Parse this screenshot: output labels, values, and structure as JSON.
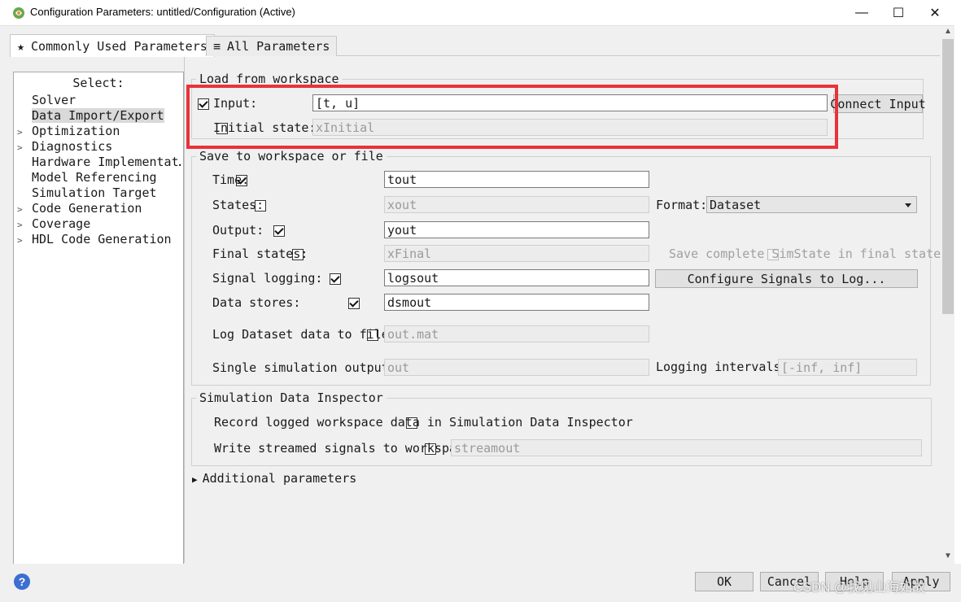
{
  "window": {
    "title": "Configuration Parameters: untitled/Configuration (Active)",
    "minimize": "—",
    "maximize": "☐",
    "close": "✕"
  },
  "tabs": [
    {
      "label": "Commonly Used Parameters",
      "icon": "star-icon",
      "active": true
    },
    {
      "label": "All Parameters",
      "icon": "list-icon",
      "active": false
    }
  ],
  "tree": {
    "title": "Select:",
    "items": [
      {
        "label": "Solver",
        "expandable": false
      },
      {
        "label": "Data Import/Export",
        "expandable": false,
        "selected": true
      },
      {
        "label": "Optimization",
        "expandable": true
      },
      {
        "label": "Diagnostics",
        "expandable": true
      },
      {
        "label": "Hardware Implementat…",
        "expandable": false
      },
      {
        "label": "Model Referencing",
        "expandable": false
      },
      {
        "label": "Simulation Target",
        "expandable": false
      },
      {
        "label": "Code Generation",
        "expandable": true
      },
      {
        "label": "Coverage",
        "expandable": true
      },
      {
        "label": "HDL Code Generation",
        "expandable": true
      }
    ]
  },
  "load": {
    "legend": "Load from workspace",
    "input": {
      "label": "Input:",
      "checked": true,
      "value": "[t, u]"
    },
    "initial_state": {
      "label": "Initial state:",
      "checked": false,
      "value": "xInitial"
    },
    "connect_button": "Connect Input"
  },
  "save": {
    "legend": "Save to workspace or file",
    "time": {
      "label": "Time:",
      "checked": true,
      "value": "tout"
    },
    "states": {
      "label": "States:",
      "checked": false,
      "value": "xout"
    },
    "format_label": "Format:",
    "format_value": "Dataset",
    "output": {
      "label": "Output:",
      "checked": true,
      "value": "yout"
    },
    "final_states": {
      "label": "Final states:",
      "checked": false,
      "value": "xFinal"
    },
    "save_simstate": {
      "label": "Save complete SimState in final state",
      "checked": false
    },
    "signal_logging": {
      "label": "Signal logging:",
      "checked": true,
      "value": "logsout"
    },
    "configure_button": "Configure Signals to Log...",
    "data_stores": {
      "label": "Data stores:",
      "checked": true,
      "value": "dsmout"
    },
    "log_dataset": {
      "label": "Log Dataset data to file:",
      "checked": false,
      "value": "out.mat"
    },
    "single_output": {
      "label": "Single simulation output:",
      "checked": false,
      "value": "out"
    },
    "logging_intervals_label": "Logging intervals:",
    "logging_intervals_value": "[-inf, inf]"
  },
  "sdi": {
    "legend": "Simulation Data Inspector",
    "record": {
      "label": "Record logged workspace data in Simulation Data Inspector",
      "checked": false
    },
    "streamed": {
      "label": "Write streamed signals to workspace",
      "checked": false,
      "value": "streamout"
    }
  },
  "additional": "Additional parameters",
  "footer": {
    "ok": "OK",
    "cancel": "Cancel",
    "help": "Help",
    "apply": "Apply"
  },
  "watermark": "CSDN @我见山海如故",
  "colors": {
    "highlight": "#e8333a",
    "help_icon": "#3b6fd1"
  }
}
